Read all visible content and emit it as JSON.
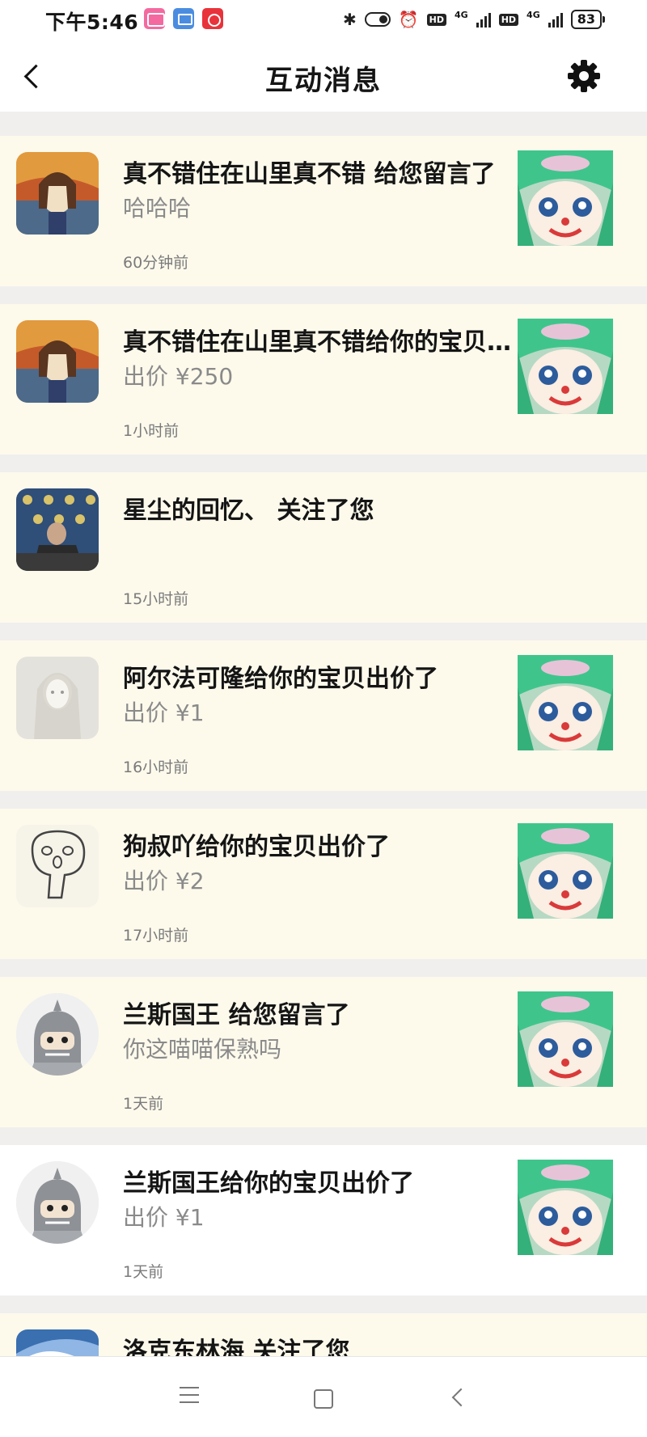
{
  "status_bar": {
    "time": "下午5:46",
    "network_1": "4G",
    "network_2": "4G",
    "hd_1": "HD",
    "hd_2": "HD",
    "battery": "83"
  },
  "nav": {
    "title": "互动消息"
  },
  "messages": [
    {
      "title": "真不错住在山里真不错 给您留言了",
      "subtitle": "哈哈哈",
      "time": "60分钟前",
      "avatar": "scream-girl-avatar",
      "thumbnail": "clown-anime-girl-thumbnail"
    },
    {
      "title": "真不错住在山里真不错给你的宝贝出价了",
      "subtitle": "出价 ¥250",
      "time": "1小时前",
      "avatar": "scream-girl-avatar",
      "thumbnail": "clown-anime-girl-thumbnail"
    },
    {
      "title": "星尘的回忆、 关注了您",
      "subtitle": "",
      "time": "15小时前",
      "avatar": "press-conference-avatar",
      "thumbnail": ""
    },
    {
      "title": "阿尔法可隆给你的宝贝出价了",
      "subtitle": "出价 ¥1",
      "time": "16小时前",
      "avatar": "ghost-girl-avatar",
      "thumbnail": "clown-anime-girl-thumbnail"
    },
    {
      "title": "狗叔吖给你的宝贝出价了",
      "subtitle": "出价 ¥2",
      "time": "17小时前",
      "avatar": "sketch-face-avatar",
      "thumbnail": "clown-anime-girl-thumbnail"
    },
    {
      "title": "兰斯国王 给您留言了",
      "subtitle": "你这喵喵保熟吗",
      "time": "1天前",
      "avatar": "shark-hood-avatar",
      "thumbnail": "clown-anime-girl-thumbnail"
    },
    {
      "title": "兰斯国王给你的宝贝出价了",
      "subtitle": "出价 ¥1",
      "time": "1天前",
      "avatar": "shark-hood-avatar",
      "thumbnail": "clown-anime-girl-thumbnail"
    },
    {
      "title": "洛克东林海 关注了您",
      "subtitle": "",
      "time": "",
      "avatar": "blue-art-avatar",
      "thumbnail": ""
    }
  ],
  "colors": {
    "card_bg": "#fdfaec",
    "card_bg_read": "#ffffff",
    "page_bg": "#f0efee"
  }
}
